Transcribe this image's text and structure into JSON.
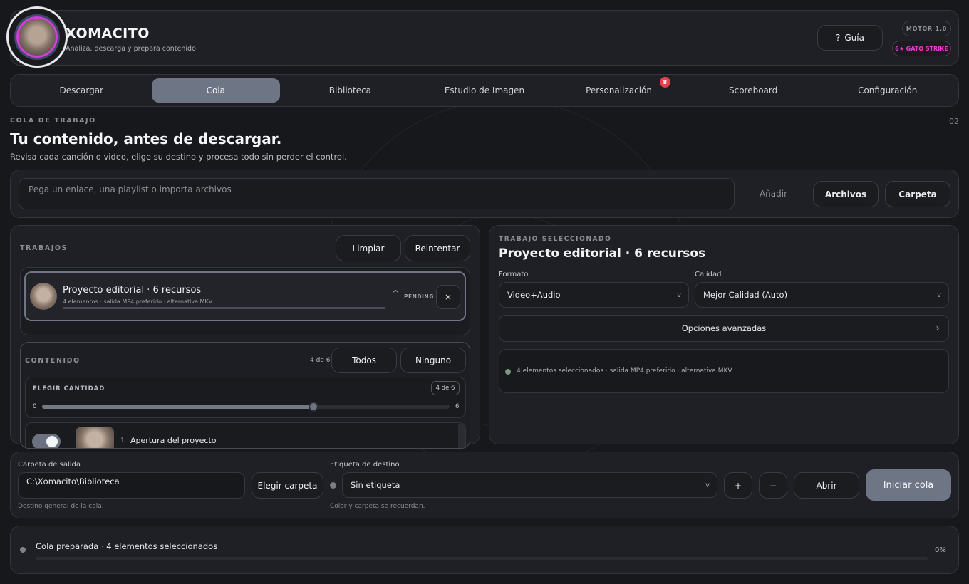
{
  "brand": {
    "name": "XOMACITO",
    "tagline": "Analiza, descarga y prepara contenido"
  },
  "header": {
    "guide_icon": "?",
    "guide_label": "Guía",
    "engine_badge": "MOTOR 1.0",
    "strike_badge": "6★ GATO STRIKE"
  },
  "tabs": [
    {
      "label": "Descargar"
    },
    {
      "label": "Cola",
      "active": true
    },
    {
      "label": "Biblioteca"
    },
    {
      "label": "Estudio de Imagen"
    },
    {
      "label": "Personalización",
      "badge": "8"
    },
    {
      "label": "Scoreboard"
    },
    {
      "label": "Configuración"
    }
  ],
  "page": {
    "eyebrow": "COLA DE TRABAJO",
    "step": "02",
    "title": "Tu contenido, antes de descargar.",
    "subtitle": "Revisa cada canción o video, elige su destino y procesa todo sin perder el control."
  },
  "add_bar": {
    "placeholder": "Pega un enlace, una playlist o importa archivos",
    "add_label": "Añadir",
    "files_label": "Archivos",
    "folder_label": "Carpeta"
  },
  "jobs": {
    "heading": "TRABAJOS",
    "clear_label": "Limpiar",
    "retry_label": "Reintentar",
    "job": {
      "title": "Proyecto editorial · 6 recursos",
      "meta": "4 elementos · salida MP4 preferido · alternativa MKV",
      "caret": "^",
      "status": "PENDING",
      "remove": "×"
    }
  },
  "content": {
    "heading": "CONTENIDO",
    "count": "4 de 6",
    "all_label": "Todos",
    "none_label": "Ninguno",
    "quantity": {
      "heading": "ELEGIR CANTIDAD",
      "badge": "4 de 6",
      "min": "0",
      "max": "6",
      "value": 4
    },
    "items": [
      {
        "index": "1.",
        "title": "Apertura del proyecto",
        "enabled": true
      }
    ]
  },
  "selected": {
    "eyebrow": "TRABAJO SELECCIONADO",
    "title": "Proyecto editorial · 6 recursos",
    "format_label": "Formato",
    "format_value": "Video+Audio",
    "quality_label": "Calidad",
    "quality_value": "Mejor Calidad (Auto)",
    "advanced_label": "Opciones avanzadas",
    "advanced_chevron": "›",
    "summary": "4 elementos seleccionados · salida MP4 preferido · alternativa MKV",
    "summary_dot_color": "#7a9a7e",
    "chevron": "v"
  },
  "output": {
    "folder_label": "Carpeta de salida",
    "folder_value": "C:\\Xomacito\\Biblioteca",
    "folder_hint": "Destino general de la cola.",
    "choose_label": "Elegir carpeta",
    "tag_label": "Etiqueta de destino",
    "tag_value": "Sin etiqueta",
    "tag_hint": "Color y carpeta se recuerdan.",
    "plus": "+",
    "minus": "−",
    "open_label": "Abrir",
    "start_label": "Iniciar cola"
  },
  "status": {
    "text": "Cola preparada · 4 elementos seleccionados",
    "percent": "0%",
    "progress": 0
  },
  "colors": {
    "accent": "#6e7585",
    "badge_red": "#e5434b",
    "strike_pink": "#e63fd3"
  }
}
